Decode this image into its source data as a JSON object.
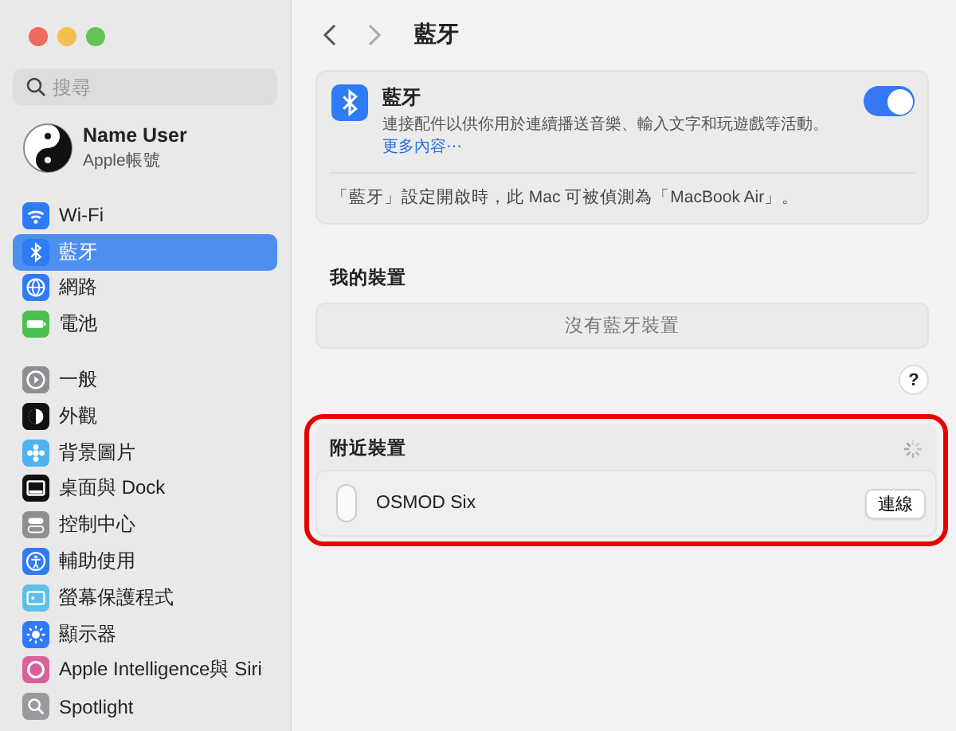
{
  "sidebar": {
    "search": {
      "placeholder": "搜尋"
    },
    "account": {
      "name": "Name User",
      "subtitle": "Apple帳號"
    },
    "groups": [
      [
        {
          "kind": "wifi",
          "label": "Wi-Fi",
          "selected": false
        },
        {
          "kind": "bluetooth",
          "label": "藍牙",
          "selected": true
        },
        {
          "kind": "network",
          "label": "網路",
          "selected": false
        },
        {
          "kind": "battery",
          "label": "電池",
          "selected": false
        }
      ],
      [
        {
          "kind": "general",
          "label": "一般",
          "selected": false
        },
        {
          "kind": "appearance",
          "label": "外觀",
          "selected": false
        },
        {
          "kind": "wallpaper",
          "label": "背景圖片",
          "selected": false
        },
        {
          "kind": "desktop",
          "label": "桌面與 Dock",
          "selected": false
        },
        {
          "kind": "control",
          "label": "控制中心",
          "selected": false
        },
        {
          "kind": "accessibility",
          "label": "輔助使用",
          "selected": false
        },
        {
          "kind": "screensaver",
          "label": "螢幕保護程式",
          "selected": false
        },
        {
          "kind": "display",
          "label": "顯示器",
          "selected": false
        },
        {
          "kind": "siri",
          "label": "Apple Intelligence與 Siri",
          "selected": false
        },
        {
          "kind": "spotlight",
          "label": "Spotlight",
          "selected": false
        }
      ]
    ]
  },
  "header": {
    "title": "藍牙"
  },
  "bluetooth_card": {
    "title": "藍牙",
    "description": "連接配件以供你用於連續播送音樂、輸入文字和玩遊戲等活動。",
    "link": "更多內容⋯",
    "on": true,
    "note": "「藍牙」設定開啟時，此 Mac 可被偵測為「MacBook Air」。"
  },
  "my_devices": {
    "heading": "我的裝置",
    "empty": "沒有藍牙裝置",
    "help": "?"
  },
  "nearby": {
    "heading": "附近裝置",
    "highlighted": true,
    "devices": [
      {
        "name": "OSMOD Six",
        "button": "連線"
      }
    ]
  }
}
